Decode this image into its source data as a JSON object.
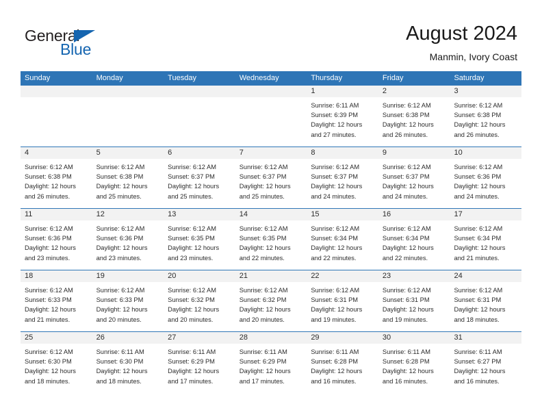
{
  "brand": {
    "name_part1": "General",
    "name_part2": "Blue",
    "triangle_color": "#1565b0",
    "text_color": "#231f20"
  },
  "header": {
    "title": "August 2024",
    "subtitle": "Manmin, Ivory Coast"
  },
  "theme": {
    "header_blue": "#2e75b6",
    "day_band_gray": "#f2f2f2",
    "text": "#2b2b2b"
  },
  "weekdays": [
    "Sunday",
    "Monday",
    "Tuesday",
    "Wednesday",
    "Thursday",
    "Friday",
    "Saturday"
  ],
  "labels": {
    "sunrise_prefix": "Sunrise: ",
    "sunset_prefix": "Sunset: ",
    "daylight_prefix": "Daylight: ",
    "daylight_join": "and "
  },
  "weeks": [
    [
      {
        "day": "",
        "empty": true
      },
      {
        "day": "",
        "empty": true
      },
      {
        "day": "",
        "empty": true
      },
      {
        "day": "",
        "empty": true
      },
      {
        "day": "1",
        "sunrise": "Sunrise: 6:11 AM",
        "sunset": "Sunset: 6:39 PM",
        "daylight1": "Daylight: 12 hours",
        "daylight2": "and 27 minutes."
      },
      {
        "day": "2",
        "sunrise": "Sunrise: 6:12 AM",
        "sunset": "Sunset: 6:38 PM",
        "daylight1": "Daylight: 12 hours",
        "daylight2": "and 26 minutes."
      },
      {
        "day": "3",
        "sunrise": "Sunrise: 6:12 AM",
        "sunset": "Sunset: 6:38 PM",
        "daylight1": "Daylight: 12 hours",
        "daylight2": "and 26 minutes."
      }
    ],
    [
      {
        "day": "4",
        "sunrise": "Sunrise: 6:12 AM",
        "sunset": "Sunset: 6:38 PM",
        "daylight1": "Daylight: 12 hours",
        "daylight2": "and 26 minutes."
      },
      {
        "day": "5",
        "sunrise": "Sunrise: 6:12 AM",
        "sunset": "Sunset: 6:38 PM",
        "daylight1": "Daylight: 12 hours",
        "daylight2": "and 25 minutes."
      },
      {
        "day": "6",
        "sunrise": "Sunrise: 6:12 AM",
        "sunset": "Sunset: 6:37 PM",
        "daylight1": "Daylight: 12 hours",
        "daylight2": "and 25 minutes."
      },
      {
        "day": "7",
        "sunrise": "Sunrise: 6:12 AM",
        "sunset": "Sunset: 6:37 PM",
        "daylight1": "Daylight: 12 hours",
        "daylight2": "and 25 minutes."
      },
      {
        "day": "8",
        "sunrise": "Sunrise: 6:12 AM",
        "sunset": "Sunset: 6:37 PM",
        "daylight1": "Daylight: 12 hours",
        "daylight2": "and 24 minutes."
      },
      {
        "day": "9",
        "sunrise": "Sunrise: 6:12 AM",
        "sunset": "Sunset: 6:37 PM",
        "daylight1": "Daylight: 12 hours",
        "daylight2": "and 24 minutes."
      },
      {
        "day": "10",
        "sunrise": "Sunrise: 6:12 AM",
        "sunset": "Sunset: 6:36 PM",
        "daylight1": "Daylight: 12 hours",
        "daylight2": "and 24 minutes."
      }
    ],
    [
      {
        "day": "11",
        "sunrise": "Sunrise: 6:12 AM",
        "sunset": "Sunset: 6:36 PM",
        "daylight1": "Daylight: 12 hours",
        "daylight2": "and 23 minutes."
      },
      {
        "day": "12",
        "sunrise": "Sunrise: 6:12 AM",
        "sunset": "Sunset: 6:36 PM",
        "daylight1": "Daylight: 12 hours",
        "daylight2": "and 23 minutes."
      },
      {
        "day": "13",
        "sunrise": "Sunrise: 6:12 AM",
        "sunset": "Sunset: 6:35 PM",
        "daylight1": "Daylight: 12 hours",
        "daylight2": "and 23 minutes."
      },
      {
        "day": "14",
        "sunrise": "Sunrise: 6:12 AM",
        "sunset": "Sunset: 6:35 PM",
        "daylight1": "Daylight: 12 hours",
        "daylight2": "and 22 minutes."
      },
      {
        "day": "15",
        "sunrise": "Sunrise: 6:12 AM",
        "sunset": "Sunset: 6:34 PM",
        "daylight1": "Daylight: 12 hours",
        "daylight2": "and 22 minutes."
      },
      {
        "day": "16",
        "sunrise": "Sunrise: 6:12 AM",
        "sunset": "Sunset: 6:34 PM",
        "daylight1": "Daylight: 12 hours",
        "daylight2": "and 22 minutes."
      },
      {
        "day": "17",
        "sunrise": "Sunrise: 6:12 AM",
        "sunset": "Sunset: 6:34 PM",
        "daylight1": "Daylight: 12 hours",
        "daylight2": "and 21 minutes."
      }
    ],
    [
      {
        "day": "18",
        "sunrise": "Sunrise: 6:12 AM",
        "sunset": "Sunset: 6:33 PM",
        "daylight1": "Daylight: 12 hours",
        "daylight2": "and 21 minutes."
      },
      {
        "day": "19",
        "sunrise": "Sunrise: 6:12 AM",
        "sunset": "Sunset: 6:33 PM",
        "daylight1": "Daylight: 12 hours",
        "daylight2": "and 20 minutes."
      },
      {
        "day": "20",
        "sunrise": "Sunrise: 6:12 AM",
        "sunset": "Sunset: 6:32 PM",
        "daylight1": "Daylight: 12 hours",
        "daylight2": "and 20 minutes."
      },
      {
        "day": "21",
        "sunrise": "Sunrise: 6:12 AM",
        "sunset": "Sunset: 6:32 PM",
        "daylight1": "Daylight: 12 hours",
        "daylight2": "and 20 minutes."
      },
      {
        "day": "22",
        "sunrise": "Sunrise: 6:12 AM",
        "sunset": "Sunset: 6:31 PM",
        "daylight1": "Daylight: 12 hours",
        "daylight2": "and 19 minutes."
      },
      {
        "day": "23",
        "sunrise": "Sunrise: 6:12 AM",
        "sunset": "Sunset: 6:31 PM",
        "daylight1": "Daylight: 12 hours",
        "daylight2": "and 19 minutes."
      },
      {
        "day": "24",
        "sunrise": "Sunrise: 6:12 AM",
        "sunset": "Sunset: 6:31 PM",
        "daylight1": "Daylight: 12 hours",
        "daylight2": "and 18 minutes."
      }
    ],
    [
      {
        "day": "25",
        "sunrise": "Sunrise: 6:12 AM",
        "sunset": "Sunset: 6:30 PM",
        "daylight1": "Daylight: 12 hours",
        "daylight2": "and 18 minutes."
      },
      {
        "day": "26",
        "sunrise": "Sunrise: 6:11 AM",
        "sunset": "Sunset: 6:30 PM",
        "daylight1": "Daylight: 12 hours",
        "daylight2": "and 18 minutes."
      },
      {
        "day": "27",
        "sunrise": "Sunrise: 6:11 AM",
        "sunset": "Sunset: 6:29 PM",
        "daylight1": "Daylight: 12 hours",
        "daylight2": "and 17 minutes."
      },
      {
        "day": "28",
        "sunrise": "Sunrise: 6:11 AM",
        "sunset": "Sunset: 6:29 PM",
        "daylight1": "Daylight: 12 hours",
        "daylight2": "and 17 minutes."
      },
      {
        "day": "29",
        "sunrise": "Sunrise: 6:11 AM",
        "sunset": "Sunset: 6:28 PM",
        "daylight1": "Daylight: 12 hours",
        "daylight2": "and 16 minutes."
      },
      {
        "day": "30",
        "sunrise": "Sunrise: 6:11 AM",
        "sunset": "Sunset: 6:28 PM",
        "daylight1": "Daylight: 12 hours",
        "daylight2": "and 16 minutes."
      },
      {
        "day": "31",
        "sunrise": "Sunrise: 6:11 AM",
        "sunset": "Sunset: 6:27 PM",
        "daylight1": "Daylight: 12 hours",
        "daylight2": "and 16 minutes."
      }
    ]
  ]
}
